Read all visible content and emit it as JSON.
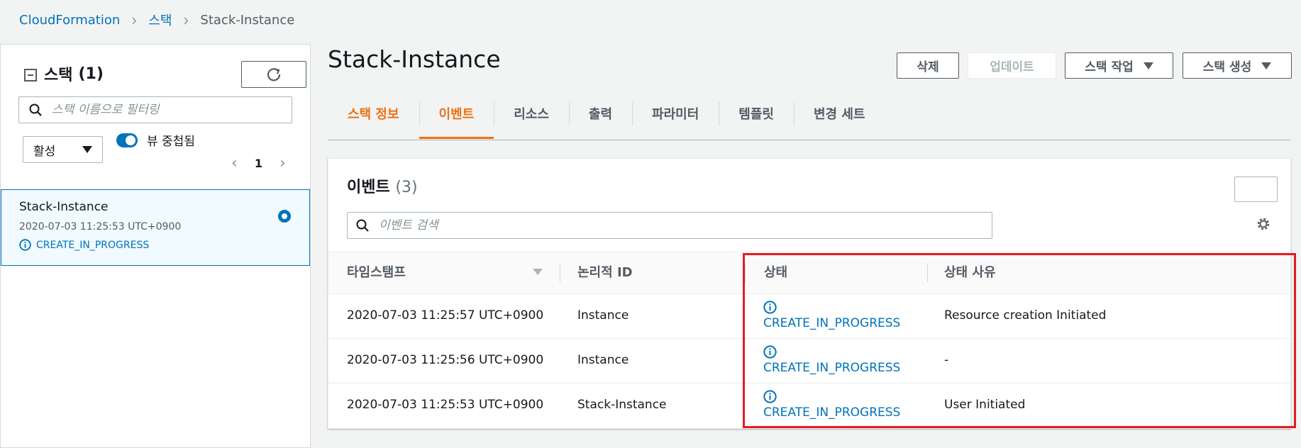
{
  "breadcrumb": {
    "root": "CloudFormation",
    "middle": "스택",
    "current": "Stack-Instance"
  },
  "left_panel": {
    "title": "스택",
    "count": "(1)",
    "search_placeholder": "스택 이름으로 필터링",
    "filter_value": "활성",
    "toggle_label": "뷰 중첩됨",
    "page_number": "1",
    "stack": {
      "name": "Stack-Instance",
      "time": "2020-07-03 11:25:53 UTC+0900",
      "status": "CREATE_IN_PROGRESS"
    }
  },
  "header": {
    "title": "Stack-Instance",
    "buttons": {
      "delete": "삭제",
      "update": "업데이트",
      "stack_actions": "스택 작업",
      "create_stack": "스택 생성"
    }
  },
  "tabs": [
    "스택 정보",
    "이벤트",
    "리소스",
    "출력",
    "파라미터",
    "템플릿",
    "변경 세트"
  ],
  "events": {
    "title": "이벤트",
    "count": "(3)",
    "search_placeholder": "이벤트 검색",
    "columns": [
      "타임스탬프",
      "논리적 ID",
      "상태",
      "상태 사유"
    ],
    "rows": [
      {
        "timestamp": "2020-07-03 11:25:57 UTC+0900",
        "logical_id": "Instance",
        "status": "CREATE_IN_PROGRESS",
        "reason": "Resource creation Initiated"
      },
      {
        "timestamp": "2020-07-03 11:25:56 UTC+0900",
        "logical_id": "Instance",
        "status": "CREATE_IN_PROGRESS",
        "reason": "-"
      },
      {
        "timestamp": "2020-07-03 11:25:53 UTC+0900",
        "logical_id": "Stack-Instance",
        "status": "CREATE_IN_PROGRESS",
        "reason": "User Initiated"
      }
    ]
  },
  "colors": {
    "link": "#0073bb",
    "accent": "#ec7211",
    "highlight": "#e31b23"
  }
}
